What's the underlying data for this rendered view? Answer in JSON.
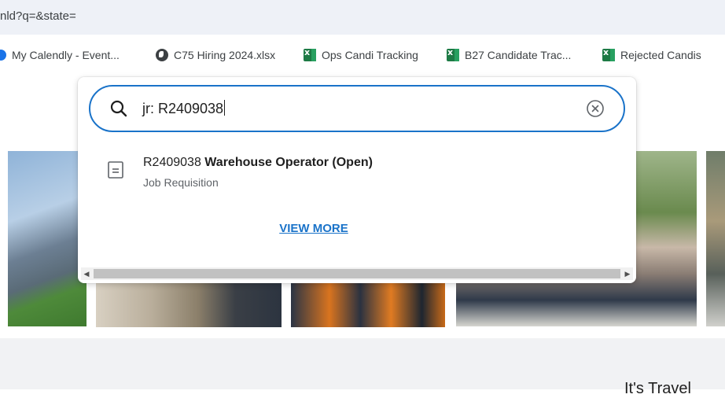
{
  "browser": {
    "url_fragment": "nld?q=&state=",
    "bookmarks": [
      {
        "label": "My Calendly - Event...",
        "icon": "calendly-icon"
      },
      {
        "label": "C75 Hiring 2024.xlsx",
        "icon": "globe-icon"
      },
      {
        "label": "Ops Candi Tracking",
        "icon": "excel-icon"
      },
      {
        "label": "B27 Candidate Trac...",
        "icon": "excel-icon"
      },
      {
        "label": "Rejected Candis",
        "icon": "excel-icon"
      }
    ]
  },
  "search": {
    "query": "jr: R2409038",
    "results": [
      {
        "id": "R2409038",
        "name": "Warehouse Operator (Open)",
        "type": "Job Requisition"
      }
    ],
    "view_more_label": "VIEW MORE"
  },
  "page": {
    "footer_partial_text": "It's Travel"
  },
  "colors": {
    "accent": "#1a73c9",
    "url_bar_bg": "#eef1f7",
    "excel_green": "#1d7a45"
  }
}
